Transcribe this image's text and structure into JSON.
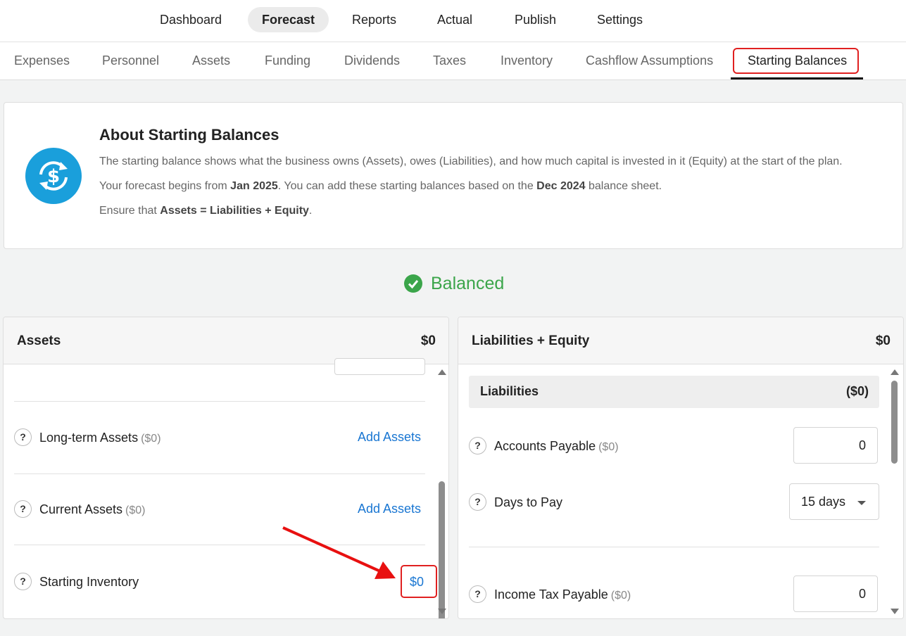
{
  "topnav": {
    "items": [
      "Dashboard",
      "Forecast",
      "Reports",
      "Actual",
      "Publish",
      "Settings"
    ],
    "active": "Forecast"
  },
  "subnav": {
    "items": [
      "Expenses",
      "Personnel",
      "Assets",
      "Funding",
      "Dividends",
      "Taxes",
      "Inventory",
      "Cashflow Assumptions",
      "Starting Balances"
    ],
    "active": "Starting Balances"
  },
  "about": {
    "title": "About Starting Balances",
    "line1": "The starting balance shows what the business owns (Assets), owes (Liabilities), and how much capital is invested in it (Equity) at the start of the plan.",
    "line2_pre": "Your forecast begins from ",
    "line2_b1": "Jan 2025",
    "line2_mid": ". You can add these starting balances based on the ",
    "line2_b2": "Dec 2024",
    "line2_post": " balance sheet.",
    "line3_pre": "Ensure that ",
    "line3_b": "Assets = Liabilities + Equity",
    "line3_post": ".",
    "icon": "currency-sync-icon"
  },
  "status": {
    "label": "Balanced",
    "color": "#3ba54a",
    "icon": "check-circle-icon"
  },
  "assets_panel": {
    "title": "Assets",
    "total": "$0",
    "rows": [
      {
        "label": "Long-term Assets",
        "amount": "($0)",
        "action": "Add Assets"
      },
      {
        "label": "Current Assets",
        "amount": "($0)",
        "action": "Add Assets"
      },
      {
        "label": "Starting Inventory",
        "value": "$0"
      }
    ]
  },
  "liabilities_panel": {
    "title": "Liabilities + Equity",
    "total": "$0",
    "section": {
      "title": "Liabilities",
      "total": "($0)"
    },
    "rows": [
      {
        "label": "Accounts Payable",
        "amount": "($0)",
        "value": "0"
      },
      {
        "label": "Days to Pay",
        "value": "15 days"
      },
      {
        "label": "Income Tax Payable",
        "amount": "($0)",
        "value": "0"
      }
    ]
  },
  "help_glyph": "?",
  "accent_colors": {
    "link": "#1976d2",
    "highlight": "#e02020",
    "brand": "#1a9fdb"
  }
}
